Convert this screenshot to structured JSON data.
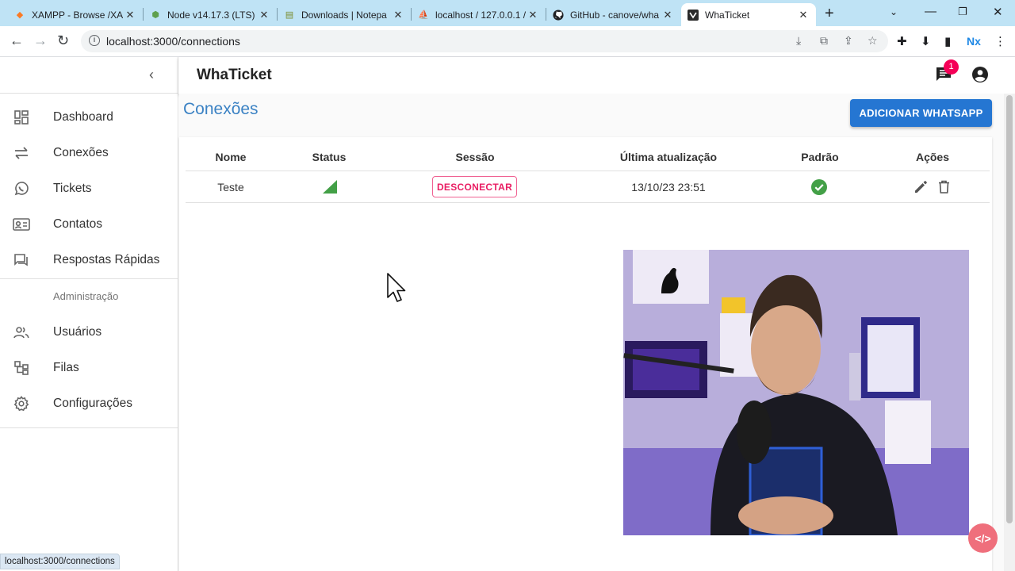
{
  "browser": {
    "tabs": [
      {
        "title": "XAMPP - Browse /XA",
        "icon": "xampp-icon",
        "active": false
      },
      {
        "title": "Node v14.17.3 (LTS) |",
        "icon": "node-icon",
        "active": false
      },
      {
        "title": "Downloads | Notepa",
        "icon": "notepad-icon",
        "active": false
      },
      {
        "title": "localhost / 127.0.0.1 /",
        "icon": "phpmyadmin-icon",
        "active": false
      },
      {
        "title": "GitHub - canove/wha",
        "icon": "github-icon",
        "active": false
      },
      {
        "title": "WhaTicket",
        "icon": "whaticket-icon",
        "active": true
      }
    ],
    "url": "localhost:3000/connections",
    "extension_label": "Nx",
    "status_url": "localhost:3000/connections"
  },
  "app": {
    "title": "WhaTicket",
    "notification_count": "1"
  },
  "sidebar": {
    "items": [
      {
        "label": "Dashboard",
        "icon": "dashboard-icon"
      },
      {
        "label": "Conexões",
        "icon": "sync-arrows-icon"
      },
      {
        "label": "Tickets",
        "icon": "whatsapp-icon"
      },
      {
        "label": "Contatos",
        "icon": "contact-card-icon"
      },
      {
        "label": "Respostas Rápidas",
        "icon": "quick-reply-icon"
      }
    ],
    "admin_header": "Administração",
    "admin_items": [
      {
        "label": "Usuários",
        "icon": "people-icon"
      },
      {
        "label": "Filas",
        "icon": "queue-icon"
      },
      {
        "label": "Configurações",
        "icon": "gear-icon"
      }
    ]
  },
  "page": {
    "title": "Conexões",
    "add_button": "ADICIONAR WHATSAPP",
    "table": {
      "headers": [
        "Nome",
        "Status",
        "Sessão",
        "Última atualização",
        "Padrão",
        "Ações"
      ],
      "rows": [
        {
          "name": "Teste",
          "status_icon": "signal-cellular-icon",
          "session_button": "DESCONECTAR",
          "updated": "13/10/23 23:51",
          "default_icon": "check-circle-icon"
        }
      ]
    }
  },
  "colors": {
    "accent_blue": "#2576d2",
    "title_blue": "#3b82c4",
    "danger_pink": "#e91e63",
    "success_green": "#43a047",
    "tabbar": "#bfe3f5"
  }
}
